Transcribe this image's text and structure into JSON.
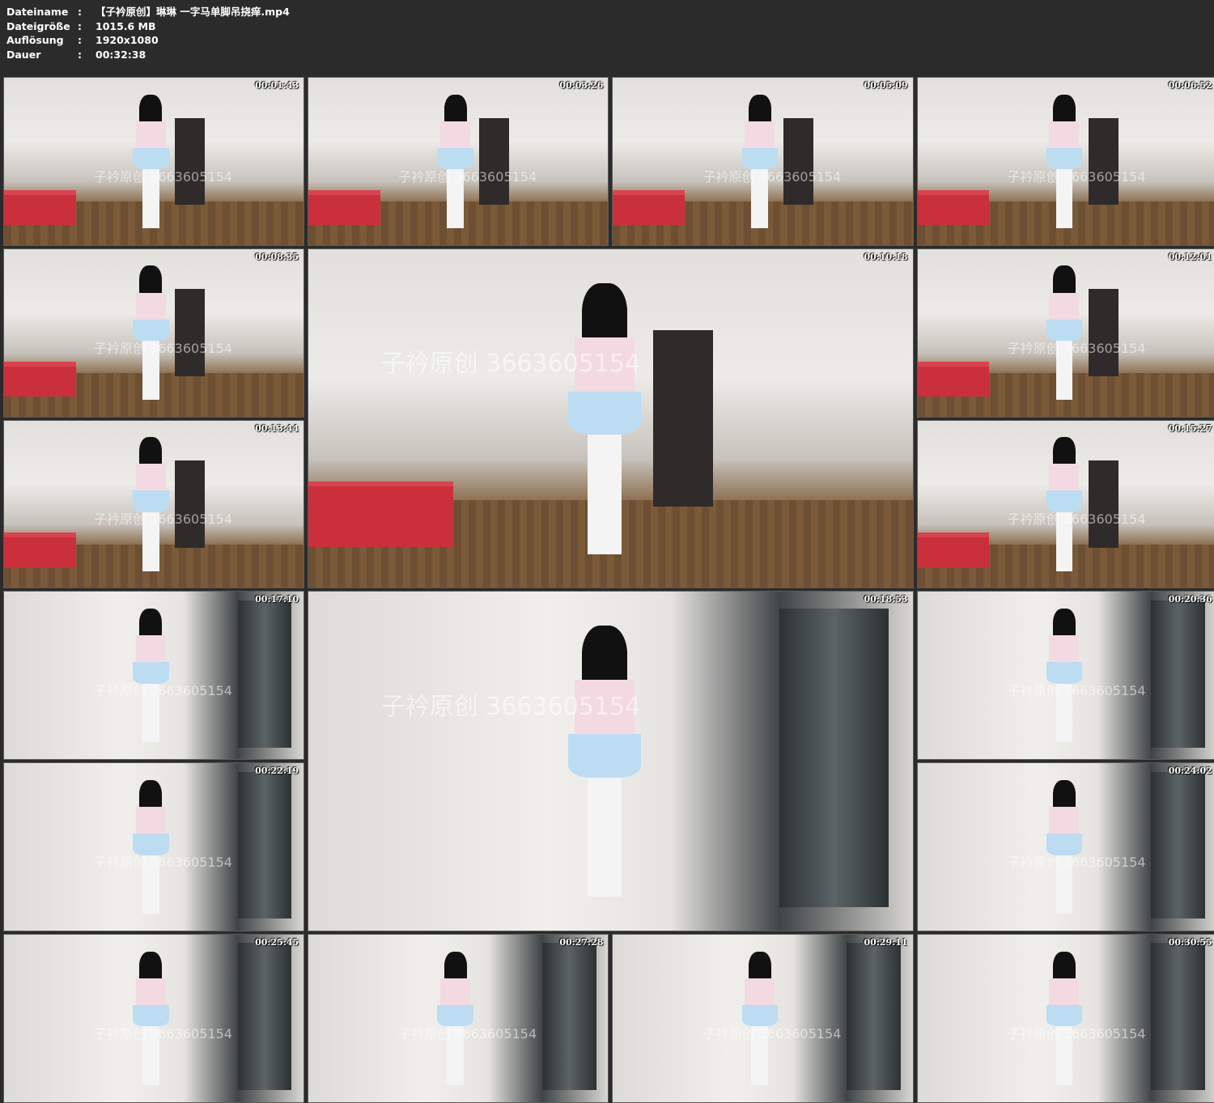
{
  "info": {
    "separator": ":",
    "rows": [
      {
        "label": "Dateiname",
        "value": "【子衿原创】琳琳 一字马单脚吊挠痒.mp4"
      },
      {
        "label": "Dateigröße",
        "value": "1015.6 MB"
      },
      {
        "label": "Auflösung",
        "value": "1920x1080"
      },
      {
        "label": "Dauer",
        "value": "00:32:38"
      }
    ]
  },
  "thumbnails": [
    {
      "timestamp": "00:01:43",
      "watermark": "子衿原创 3663605154"
    },
    {
      "timestamp": "00:03:26",
      "watermark": "子衿原创 3663605154"
    },
    {
      "timestamp": "00:05:09",
      "watermark": "子衿原创 3663605154"
    },
    {
      "timestamp": "00:06:52",
      "watermark": "子衿原创 3663605154"
    },
    {
      "timestamp": "00:08:35",
      "watermark": "子衿原创 3663605154"
    },
    {
      "timestamp": "00:10:18",
      "watermark": "子衿原创 3663605154"
    },
    {
      "timestamp": "00:12:01",
      "watermark": "子衿原创 3663605154"
    },
    {
      "timestamp": "00:13:44",
      "watermark": "子衿原创 3663605154"
    },
    {
      "timestamp": "00:15:27",
      "watermark": "子衿原创 3663605154"
    },
    {
      "timestamp": "00:17:10",
      "watermark": "子衿原创 3663605154"
    },
    {
      "timestamp": "00:18:53",
      "watermark": "子衿原创 3663605154"
    },
    {
      "timestamp": "00:20:36",
      "watermark": "子衿原创 3663605154"
    },
    {
      "timestamp": "00:22:19",
      "watermark": "子衿原创 3663605154"
    },
    {
      "timestamp": "00:24:02",
      "watermark": "子衿原创 3663605154"
    },
    {
      "timestamp": "00:25:45",
      "watermark": "子衿原创 3663605154"
    },
    {
      "timestamp": "00:27:28",
      "watermark": "子衿原创 3663605154"
    },
    {
      "timestamp": "00:29:11",
      "watermark": "子衿原创 3663605154"
    },
    {
      "timestamp": "00:30:55",
      "watermark": "子衿原创 3663605154"
    }
  ]
}
